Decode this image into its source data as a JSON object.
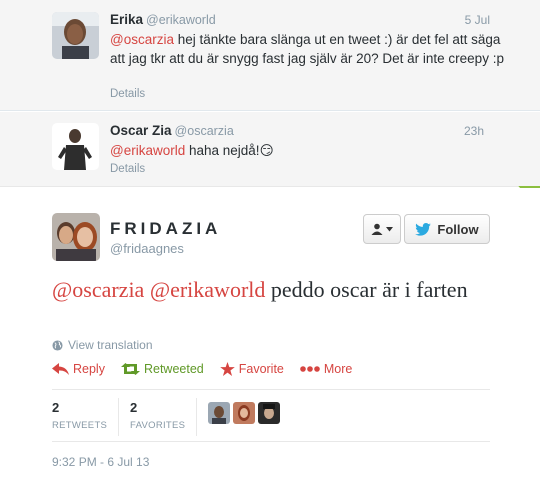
{
  "tweets": [
    {
      "fullname": "Erika",
      "handle": "@erikaworld",
      "time": "5 Jul",
      "mention": "@oscarzia",
      "text": " hej tänkte bara slänga ut en tweet :) är det fel att säga att jag tkr att du är snygg fast jag själv är 20? Det är inte creepy :p",
      "details": "Details"
    },
    {
      "fullname": "Oscar Zia",
      "handle": "@oscarzia",
      "time": "23h",
      "mention": "@erikaworld",
      "text": " haha nejdå!",
      "emoji": "😏",
      "details": "Details"
    }
  ],
  "main_tweet": {
    "fullname": "FRIDAZIA",
    "handle": "@fridaagnes",
    "mention1": "@oscarzia",
    "mention2": "@erikaworld",
    "text": " peddo oscar är i farten",
    "view_translation": "View translation",
    "follow_label": "Follow",
    "actions": {
      "reply": "Reply",
      "retweeted": "Retweeted",
      "favorite": "Favorite",
      "more": "More"
    },
    "stats": {
      "retweets_count": "2",
      "retweets_label": "RETWEETS",
      "favorites_count": "2",
      "favorites_label": "FAVORITES"
    },
    "timestamp": "9:32 PM - 6 Jul 13"
  },
  "colors": {
    "mention": "#d64541",
    "retweeted": "#609928",
    "follow_bird": "#2aa9e0",
    "muted": "#8899a6"
  },
  "icons": [
    "user-dropdown-icon",
    "twitter-bird-icon",
    "globe-icon",
    "reply-icon",
    "retweet-icon",
    "star-icon",
    "more-dots-icon"
  ]
}
